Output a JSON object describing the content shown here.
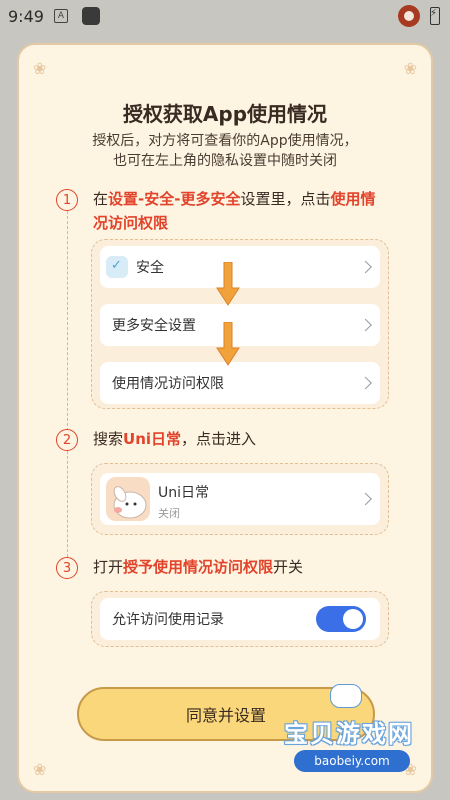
{
  "status_bar": {
    "time": "9:49",
    "icon_a": "A"
  },
  "dialog": {
    "title": "授权获取App使用情况",
    "subtitle_line1": "授权后，对方将可查看你的App使用情况，",
    "subtitle_line2": "也可在左上角的隐私设置中随时关闭"
  },
  "steps": [
    {
      "number": "1",
      "parts": [
        "在",
        "设置-安全-更多安全",
        "设置里，点击",
        "使用情",
        "况访问权限"
      ],
      "settings_rows": [
        {
          "label": "安全",
          "icon": "shield-icon"
        },
        {
          "label": "更多安全设置"
        },
        {
          "label": "使用情况访问权限"
        }
      ]
    },
    {
      "number": "2",
      "parts": [
        "搜索",
        "Uni日常",
        "，点击进入"
      ],
      "app": {
        "name": "Uni日常",
        "status": "关闭"
      }
    },
    {
      "number": "3",
      "parts": [
        "打开",
        "授予使用情况访问权限",
        "开关"
      ],
      "toggle_row": {
        "label": "允许访问使用记录",
        "enabled": true
      }
    }
  ],
  "agree_button": "同意并设置",
  "watermark": {
    "text": "宝贝游戏网",
    "url": "baobeiy.com"
  },
  "colors": {
    "accent": "#e2432b",
    "toggle": "#3a6fe8",
    "button": "#f9d77a"
  }
}
